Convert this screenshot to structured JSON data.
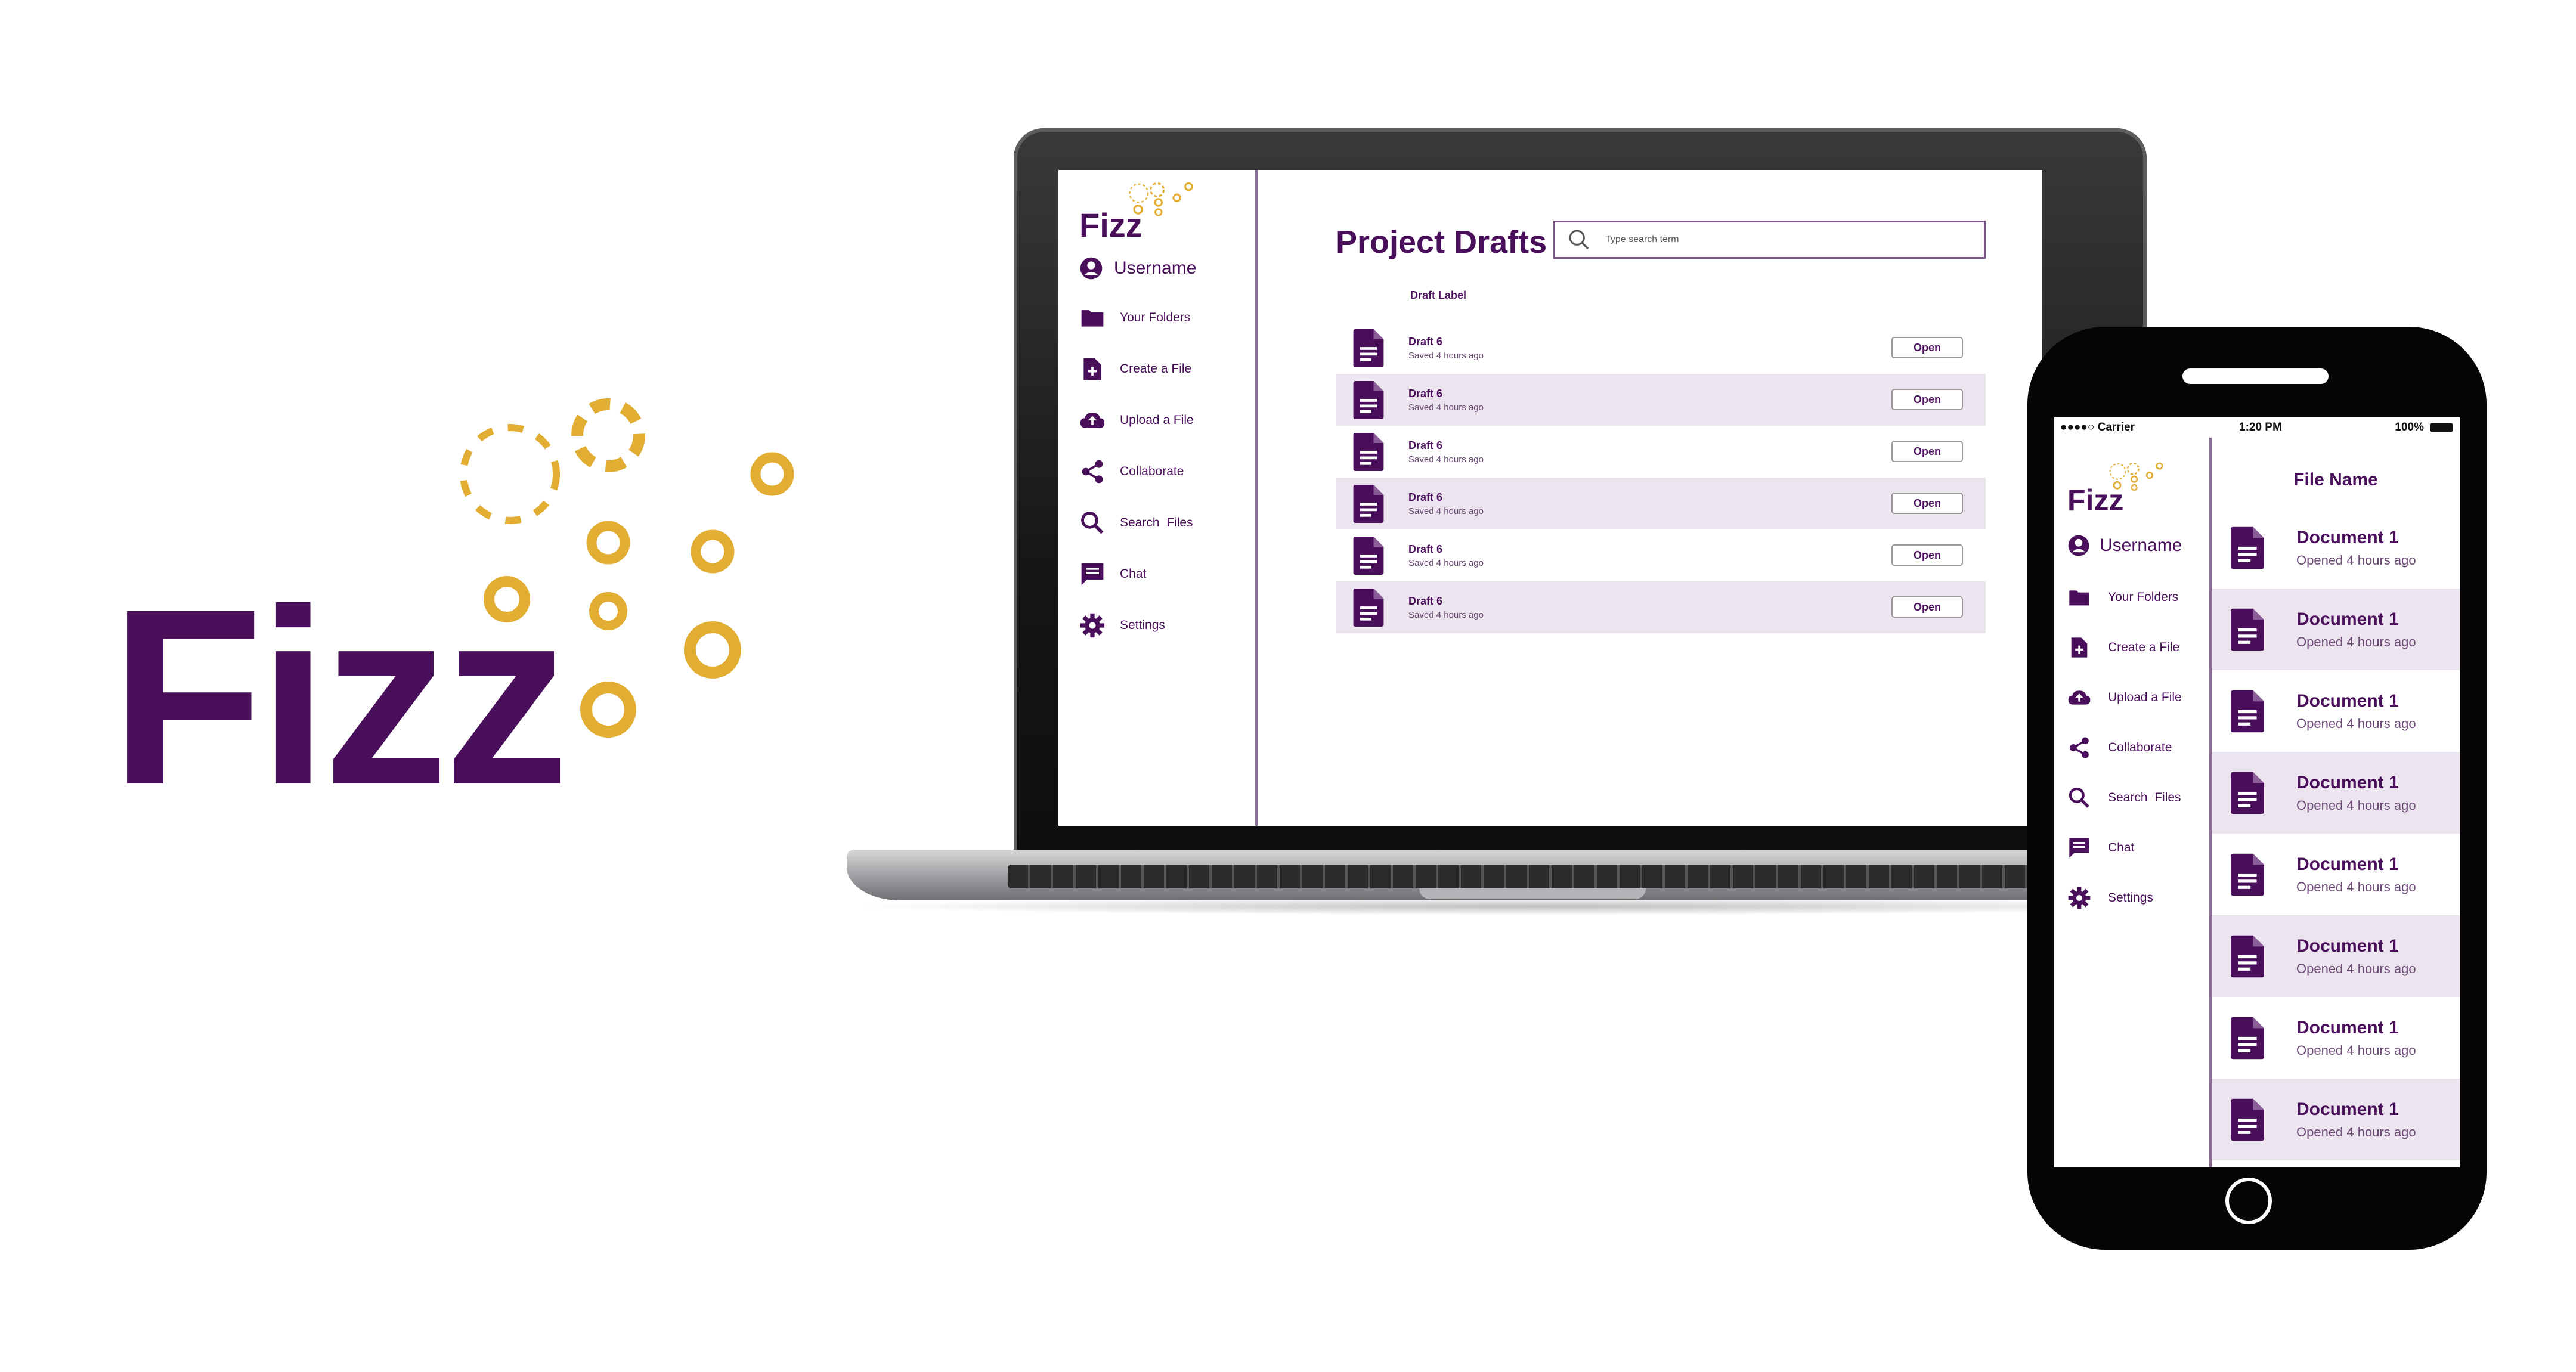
{
  "brand": {
    "logo_text": "Fizz",
    "primary_color": "#4a0f5a",
    "accent_color": "#e2ad33",
    "row_alt_color": "#ece4ee"
  },
  "laptop": {
    "sidebar": {
      "username": "Username",
      "items": [
        {
          "label": "Your Folders",
          "icon": "folder-icon"
        },
        {
          "label": "Create a File",
          "icon": "file-plus-icon"
        },
        {
          "label": "Upload a File",
          "icon": "cloud-upload-icon"
        },
        {
          "label": "Collaborate",
          "icon": "share-icon"
        },
        {
          "label": "Search  Files",
          "icon": "search-icon"
        },
        {
          "label": "Chat",
          "icon": "chat-icon"
        },
        {
          "label": "Settings",
          "icon": "gear-icon"
        }
      ]
    },
    "main": {
      "title": "Project Drafts",
      "search_placeholder": "Type search term",
      "column_label": "Draft Label",
      "open_label": "Open",
      "rows": [
        {
          "name": "Draft 6",
          "status": "Saved 4 hours ago"
        },
        {
          "name": "Draft 6",
          "status": "Saved 4 hours ago"
        },
        {
          "name": "Draft 6",
          "status": "Saved 4 hours ago"
        },
        {
          "name": "Draft 6",
          "status": "Saved 4 hours ago"
        },
        {
          "name": "Draft 6",
          "status": "Saved 4 hours ago"
        },
        {
          "name": "Draft 6",
          "status": "Saved 4 hours ago"
        }
      ]
    }
  },
  "phone": {
    "status_bar": {
      "carrier": "●●●●○ Carrier",
      "time": "1:20 PM",
      "battery": "100%"
    },
    "sidebar": {
      "username": "Username",
      "items": [
        {
          "label": "Your Folders",
          "icon": "folder-icon"
        },
        {
          "label": "Create a File",
          "icon": "file-plus-icon"
        },
        {
          "label": "Upload a File",
          "icon": "cloud-upload-icon"
        },
        {
          "label": "Collaborate",
          "icon": "share-icon"
        },
        {
          "label": "Search  Files",
          "icon": "search-icon"
        },
        {
          "label": "Chat",
          "icon": "chat-icon"
        },
        {
          "label": "Settings",
          "icon": "gear-icon"
        }
      ]
    },
    "main": {
      "column_label": "File Name",
      "rows": [
        {
          "name": "Document 1",
          "status": "Opened 4 hours ago"
        },
        {
          "name": "Document 1",
          "status": "Opened 4 hours ago"
        },
        {
          "name": "Document 1",
          "status": "Opened 4 hours ago"
        },
        {
          "name": "Document 1",
          "status": "Opened 4 hours ago"
        },
        {
          "name": "Document 1",
          "status": "Opened 4 hours ago"
        },
        {
          "name": "Document 1",
          "status": "Opened 4 hours ago"
        },
        {
          "name": "Document 1",
          "status": "Opened 4 hours ago"
        },
        {
          "name": "Document 1",
          "status": "Opened 4 hours ago"
        }
      ]
    }
  }
}
